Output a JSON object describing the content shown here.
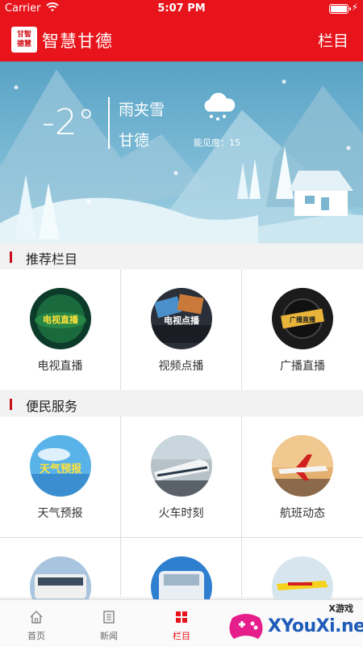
{
  "status_bar": {
    "carrier": "Carrier",
    "time": "5:07 PM"
  },
  "header": {
    "app_title": "智慧甘德",
    "logo_text": "甘智 德慧",
    "right_label": "栏目"
  },
  "weather": {
    "temperature": "-2°",
    "condition": "雨夹雪",
    "city": "甘德",
    "visibility": "能见度：15"
  },
  "sections": [
    {
      "title": "推荐栏目",
      "items": [
        {
          "label": "电视直播",
          "thumb_text": "电视直播"
        },
        {
          "label": "视频点播",
          "thumb_text": "电视点播"
        },
        {
          "label": "广播直播",
          "thumb_text": "广播直播"
        }
      ]
    },
    {
      "title": "便民服务",
      "items": [
        {
          "label": "天气预报",
          "thumb_text": "天气预报"
        },
        {
          "label": "火车时刻"
        },
        {
          "label": "航班动态"
        }
      ]
    }
  ],
  "tabs": [
    {
      "label": "首页",
      "icon": "home-icon"
    },
    {
      "label": "新闻",
      "icon": "news-icon"
    },
    {
      "label": "栏目",
      "icon": "grid-icon",
      "active": true
    }
  ],
  "watermark": {
    "top": "X游戏",
    "main": "XYouXi.net"
  },
  "colors": {
    "brand_red": "#e8141b",
    "section_bar": "#c8101b",
    "banner_sky": "#58a2c5"
  }
}
